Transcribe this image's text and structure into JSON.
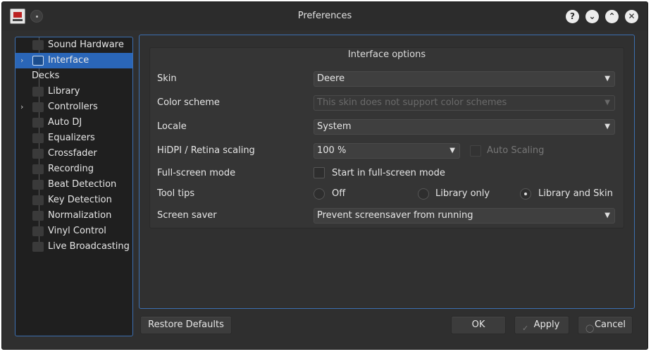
{
  "window": {
    "title": "Preferences"
  },
  "title_buttons": {
    "help": "?",
    "minimize": "⌄",
    "maximize": "⌃",
    "close": "✕"
  },
  "sidebar": {
    "items": [
      {
        "label": "Sound Hardware",
        "icon": "speaker-icon",
        "has_arrow": false
      },
      {
        "label": "Interface",
        "icon": "interface-icon",
        "has_arrow": true,
        "selected": true
      },
      {
        "label": "Decks",
        "icon": "",
        "has_arrow": false
      },
      {
        "label": "Library",
        "icon": "library-icon",
        "has_arrow": false
      },
      {
        "label": "Controllers",
        "icon": "controller-icon",
        "has_arrow": true
      },
      {
        "label": "Auto DJ",
        "icon": "autodj-icon",
        "has_arrow": false
      },
      {
        "label": "Equalizers",
        "icon": "equalizer-icon",
        "has_arrow": false
      },
      {
        "label": "Crossfader",
        "icon": "crossfader-icon",
        "has_arrow": false
      },
      {
        "label": "Recording",
        "icon": "recording-icon",
        "has_arrow": false
      },
      {
        "label": "Beat Detection",
        "icon": "beat-detection-icon",
        "has_arrow": false
      },
      {
        "label": "Key Detection",
        "icon": "key-detection-icon",
        "has_arrow": false
      },
      {
        "label": "Normalization",
        "icon": "normalization-icon",
        "has_arrow": false
      },
      {
        "label": "Vinyl Control",
        "icon": "vinyl-icon",
        "has_arrow": false
      },
      {
        "label": "Live Broadcasting",
        "icon": "broadcast-icon",
        "has_arrow": false
      }
    ]
  },
  "interface": {
    "group_title": "Interface options",
    "skin": {
      "label": "Skin",
      "value": "Deere"
    },
    "color_scheme": {
      "label": "Color scheme",
      "value": "This skin does not support color schemes"
    },
    "locale": {
      "label": "Locale",
      "value": "System"
    },
    "hidpi": {
      "label": "HiDPI / Retina scaling",
      "value": "100 %",
      "auto_label": "Auto Scaling"
    },
    "fullscreen": {
      "label": "Full-screen mode",
      "checkbox_label": "Start in full-screen mode"
    },
    "tooltips": {
      "label": "Tool tips",
      "options": [
        "Off",
        "Library only",
        "Library and Skin"
      ],
      "selected": "Library and Skin"
    },
    "screensaver": {
      "label": "Screen saver",
      "value": "Prevent screensaver from running"
    }
  },
  "buttons": {
    "restore_defaults": "Restore Defaults",
    "ok": "OK",
    "apply": "Apply",
    "cancel": "Cancel"
  },
  "colors": {
    "accent": "#2a66b8",
    "border_focus": "#3c6fb0",
    "window_bg": "#2f2f2f"
  }
}
